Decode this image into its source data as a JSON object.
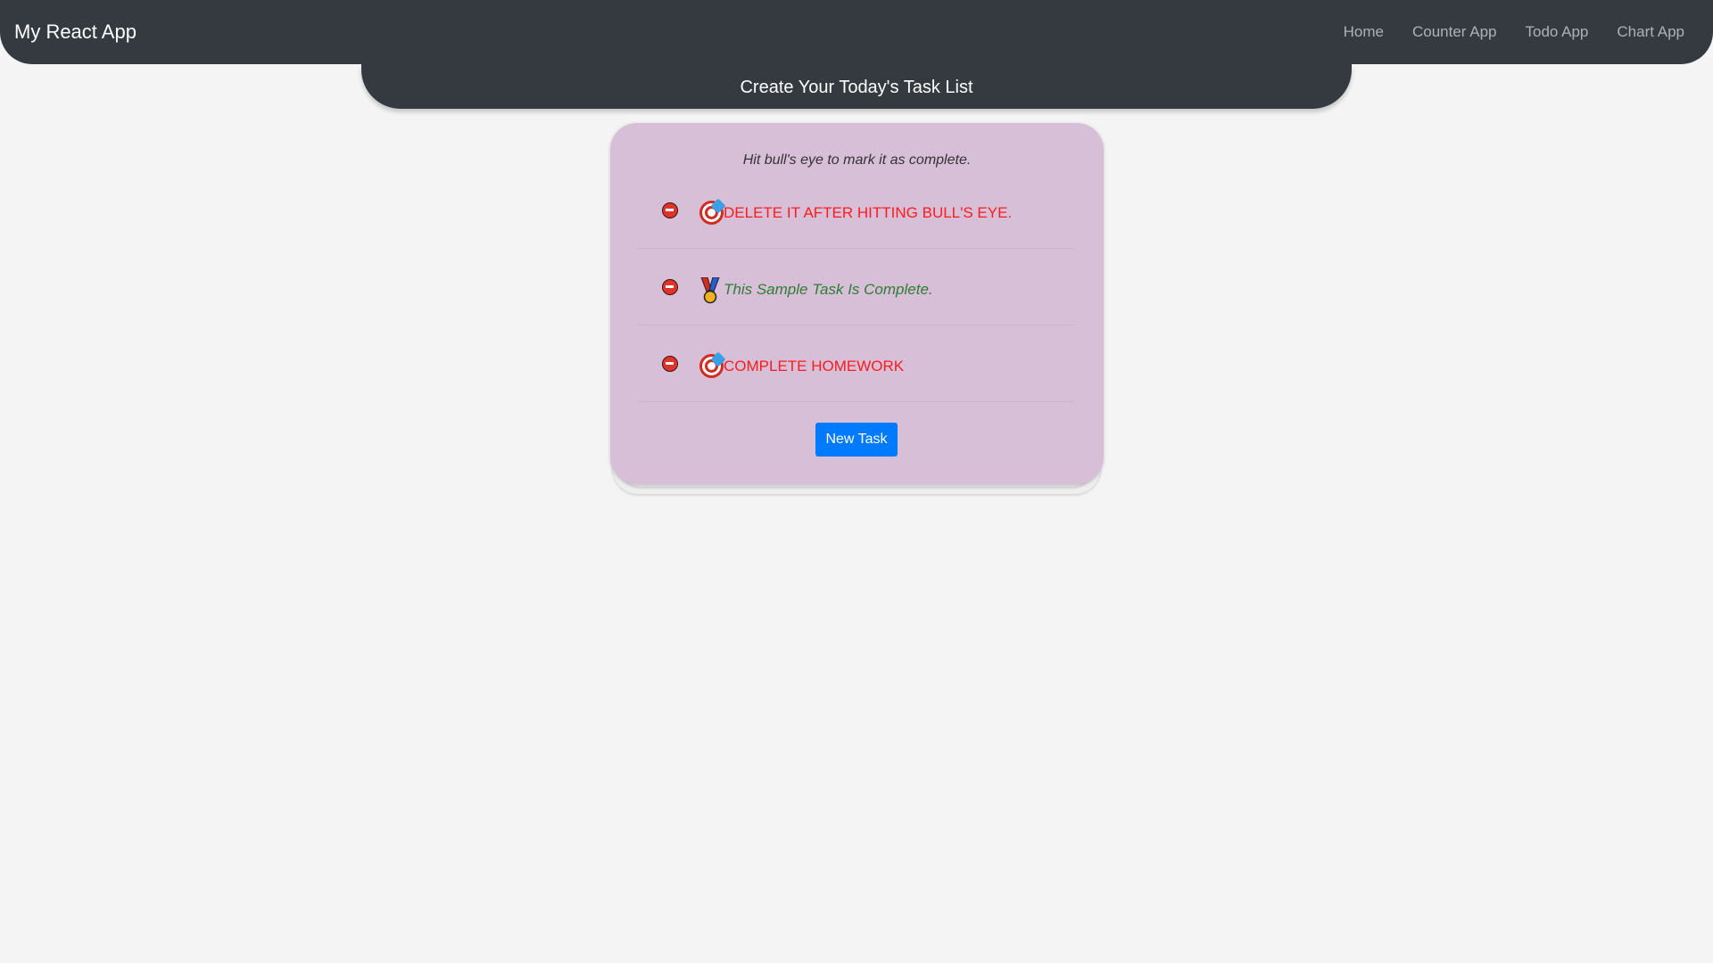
{
  "navbar": {
    "brand": "My React App",
    "links": [
      "Home",
      "Counter App",
      "Todo App",
      "Chart App"
    ],
    "background": "#343a40"
  },
  "header": {
    "title": "Create Your Today's Task List"
  },
  "card": {
    "hint": "Hit bull's eye to mark it as complete.",
    "background": "#d8bfd8",
    "tasks": [
      {
        "text": "DELETE IT AFTER HITTING BULL'S EYE.",
        "status": "pending",
        "icon": "bullseye-icon"
      },
      {
        "text": "This Sample Task Is Complete.",
        "status": "complete",
        "icon": "medal-icon"
      },
      {
        "text": "COMPLETE HOMEWORK",
        "status": "pending",
        "icon": "bullseye-icon"
      }
    ],
    "new_task_label": "New Task"
  },
  "colors": {
    "pending_text": "#ff1a1a",
    "complete_text": "#2e7d32",
    "button": "#007bff",
    "delete_icon": "#e0342b"
  }
}
